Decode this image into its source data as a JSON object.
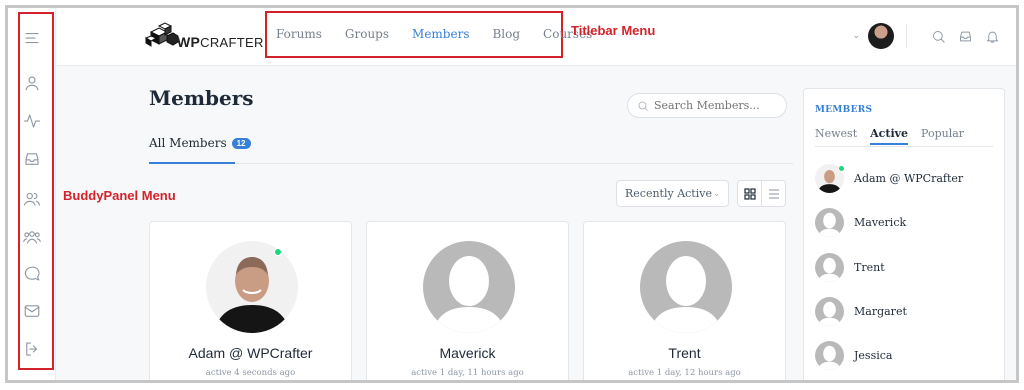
{
  "header": {
    "logo_text_bold": "WP",
    "logo_text_light": "CRAFTER",
    "nav": [
      {
        "label": "Forums",
        "active": false
      },
      {
        "label": "Groups",
        "active": false
      },
      {
        "label": "Members",
        "active": true
      },
      {
        "label": "Blog",
        "active": false
      },
      {
        "label": "Courses",
        "active": false
      }
    ],
    "titlebar_annotation": "Titlebar Menu"
  },
  "sidebar": {
    "annotation": "BuddyPanel Menu",
    "icons": [
      "menu-toggle-icon",
      "profile-icon",
      "activity-icon",
      "inbox-icon",
      "members-icon",
      "groups-icon",
      "forums-icon",
      "messages-icon",
      "logout-icon"
    ]
  },
  "main": {
    "title": "Members",
    "search_placeholder": "Search Members...",
    "tab_all_label": "All Members",
    "tab_all_count": "12",
    "sort_selected": "Recently Active",
    "cards": [
      {
        "name": "Adam @ WPCrafter",
        "active": "active 4 seconds ago",
        "online": true,
        "photo": true
      },
      {
        "name": "Maverick",
        "active": "active 1 day, 11 hours ago",
        "online": false,
        "photo": false
      },
      {
        "name": "Trent",
        "active": "active 1 day, 12 hours ago",
        "online": false,
        "photo": false
      }
    ]
  },
  "widget": {
    "title": "MEMBERS",
    "tabs": [
      {
        "label": "Newest",
        "active": false
      },
      {
        "label": "Active",
        "active": true
      },
      {
        "label": "Popular",
        "active": false
      }
    ],
    "members": [
      {
        "name": "Adam @ WPCrafter"
      },
      {
        "name": "Maverick"
      },
      {
        "name": "Trent"
      },
      {
        "name": "Margaret"
      },
      {
        "name": "Jessica"
      }
    ]
  },
  "colors": {
    "accent": "#3680d8",
    "annotation": "#d2232a",
    "online": "#1cd67c"
  }
}
